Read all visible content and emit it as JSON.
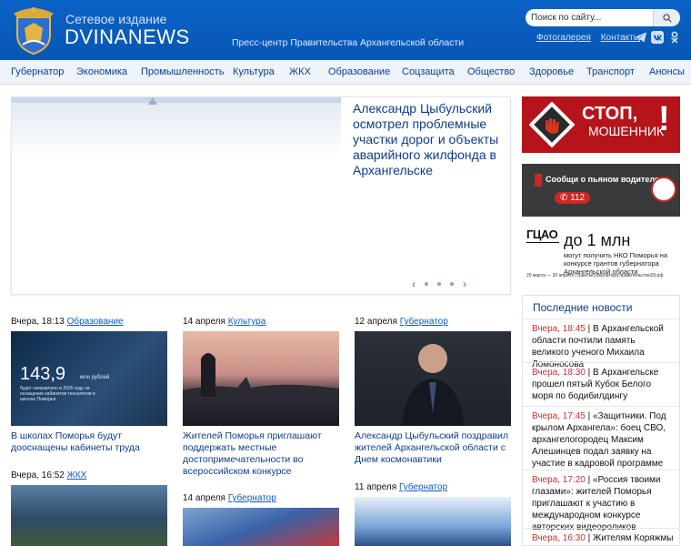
{
  "header": {
    "subtitle": "Сетевое издание",
    "title": "DVINANEWS",
    "press": "Пресс-центр Правительства Архангельской области",
    "search_placeholder": "Поиск по сайту...",
    "links": [
      "Фотогалерея",
      "Контакты"
    ],
    "social_icons": [
      "telegram-icon",
      "vk-icon",
      "ok-icon"
    ]
  },
  "nav": [
    "Губернатор",
    "Экономика",
    "Промышленность",
    "Культура",
    "ЖКХ",
    "Образование",
    "Соцзащита",
    "Общество",
    "Здоровье",
    "Транспорт",
    "Анонсы"
  ],
  "slider": {
    "title": "Александр Цыбульский осмотрел проблемные участки дорог и объекты аварийного жилфонда в Архангельске",
    "prev": "‹",
    "next": "›"
  },
  "banners": {
    "stop_title": "СТОП,",
    "stop_sub": "МОШЕННИК",
    "stop_mark": "!",
    "drunk_text": "Сообщи о пьяном водителе",
    "drunk_number": "112",
    "grant_logo": "ГЦАО",
    "grant_big": "до 1 млн",
    "grant_desc": "могут получить НКО Поморья на конкурсе грантов губернатора Архангельской области",
    "grant_foot": "20 марта — 20 апреля  |  грантыгубернатора.правительство29.рф"
  },
  "latest": {
    "title": "Последние новости",
    "items": [
      {
        "time": "Вчера, 18:45",
        "text": "В Архангельской области почтили память великого ученого Михаила Ломоносова"
      },
      {
        "time": "Вчера, 18:30",
        "text": "В Архангельске прошел пятый Кубок Белого моря по бодибилдингу"
      },
      {
        "time": "Вчера, 17:45",
        "text": "«Защитники. Под крылом Архангела»: боец СВО, архангелогородец Максим Алешинцев подал заявку на участие в кадровой программе"
      },
      {
        "time": "Вчера, 17:20",
        "text": "«Россия твоими глазами»: жителей Поморья приглашают к участию в международном конкурсе авторских видеороликов"
      },
      {
        "time": "Вчера, 16:30",
        "text": "Жителям Коряжмы"
      }
    ]
  },
  "cards": [
    {
      "date": "Вчера, 18:13",
      "category": "Образование",
      "title": "В школах Поморья будут дооснащены кабинеты труда",
      "img_number": "143,9",
      "img_unit": "млн рублей",
      "img_caption": "будет направлено в 2025 году на оснащение кабинетов технологии в школах Поморья"
    },
    {
      "date": "14 апреля",
      "category": "Культура",
      "title": "Жителей Поморья приглашают поддержать местные достопримечательности во всероссийском конкурсе"
    },
    {
      "date": "12 апреля",
      "category": "Губернатор",
      "title": "Александр Цыбульский поздравил жителей Архангельской области с Днем космонавтики"
    },
    {
      "date": "Вчера, 16:52",
      "category": "ЖКХ",
      "title": ""
    },
    {
      "date": "14 апреля",
      "category": "Губернатор",
      "title": ""
    },
    {
      "date": "11 апреля",
      "category": "Губернатор",
      "title": ""
    }
  ],
  "colors": {
    "header": "#0757b5",
    "link": "#0c3c8b",
    "accent": "#d12d2d",
    "stop": "#b5141a"
  }
}
